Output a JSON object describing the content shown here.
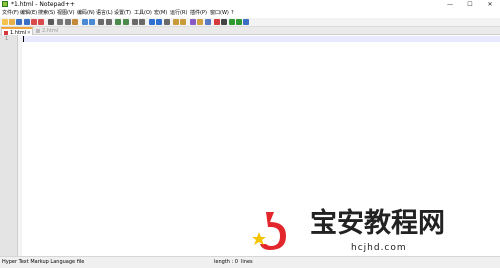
{
  "window": {
    "title": "*1.html - Notepad++",
    "minimize_glyph": "—",
    "maximize_glyph": "☐",
    "close_glyph": "✕"
  },
  "menu": {
    "items": [
      "文件(F)",
      "编辑(E)",
      "搜索(S)",
      "视图(V)",
      "编码(N)",
      "语言(L)",
      "设置(T)",
      "工具(O)",
      "宏(M)",
      "运行(R)",
      "插件(P)",
      "窗口(W)",
      "?"
    ]
  },
  "toolbar": {
    "icons": [
      "new-file-icon",
      "open-file-icon",
      "save-icon",
      "save-all-icon",
      "close-icon",
      "close-all-icon",
      "print-icon",
      "cut-icon",
      "copy-icon",
      "paste-icon",
      "undo-icon",
      "redo-icon",
      "find-icon",
      "replace-icon",
      "zoom-in-icon",
      "zoom-out-icon",
      "sync-v-icon",
      "sync-h-icon",
      "word-wrap-icon",
      "all-chars-icon",
      "indent-guide-icon",
      "udl-icon",
      "doc-map-icon",
      "func-list-icon",
      "folder-workspace-icon",
      "monitor-icon",
      "record-macro-icon",
      "stop-macro-icon",
      "play-macro-icon",
      "run-macro-multiple-icon",
      "save-macro-icon"
    ],
    "colors": [
      "#f2c14e",
      "#e8b04a",
      "#3a6fc4",
      "#3a6fc4",
      "#d94b4b",
      "#d94b4b",
      "#5a5a5a",
      "#777777",
      "#777777",
      "#c48a3a",
      "#4a8ad4",
      "#4a8ad4",
      "#6a6a6a",
      "#6a6a6a",
      "#4a8a4a",
      "#4a8a4a",
      "#6a6a6a",
      "#6a6a6a",
      "#2f6fd0",
      "#2f6fd0",
      "#6a6a6a",
      "#c89a3a",
      "#c89a3a",
      "#8a5ac4",
      "#d0a040",
      "#5a7ac4",
      "#d43a3a",
      "#444444",
      "#2f9a2f",
      "#2f9a2f",
      "#3a6fc4"
    ]
  },
  "tabs": [
    {
      "label": "1.html",
      "active": true
    },
    {
      "label": "2.html",
      "active": false
    }
  ],
  "editor": {
    "line_numbers": [
      "1"
    ],
    "current_line_color": "#e8e8ff"
  },
  "watermark": {
    "chinese_text": "宝安教程网",
    "domain": "hcjhd.com",
    "logo_colors": [
      "#e3262b",
      "#f5c400"
    ]
  },
  "statusbar": {
    "file_type": "Hyper Text Markup Language file",
    "length": "length : 0",
    "lines": "lines"
  }
}
